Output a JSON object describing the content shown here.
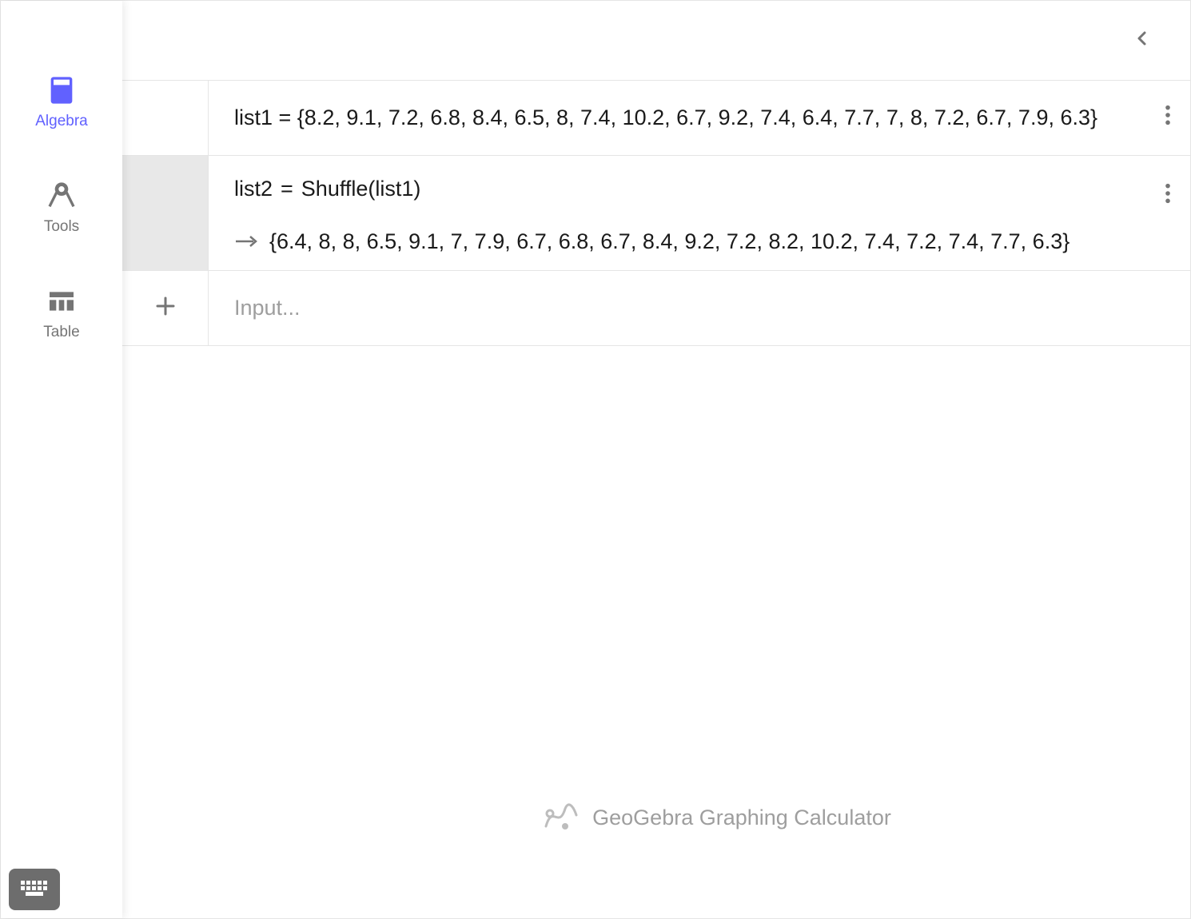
{
  "sidebar": {
    "items": [
      {
        "label": "Algebra"
      },
      {
        "label": "Tools"
      },
      {
        "label": "Table"
      }
    ]
  },
  "rows": [
    {
      "expression": "list1 = {8.2, 9.1, 7.2, 6.8, 8.4, 6.5, 8, 7.4, 10.2, 6.7, 9.2, 7.4, 6.4, 7.7, 7, 8, 7.2, 6.7, 7.9, 6.3}"
    },
    {
      "lhs": "list2",
      "rhs": "Shuffle(list1)",
      "output": "{6.4, 8, 8, 6.5, 9.1, 7, 7.9, 6.7, 6.8, 6.7, 8.4, 9.2, 7.2, 8.2, 10.2, 7.4, 7.2, 7.4, 7.7, 6.3}"
    }
  ],
  "input": {
    "placeholder": "Input..."
  },
  "footer": {
    "title": "GeoGebra Graphing Calculator"
  },
  "colors": {
    "accent": "#6161ff"
  }
}
